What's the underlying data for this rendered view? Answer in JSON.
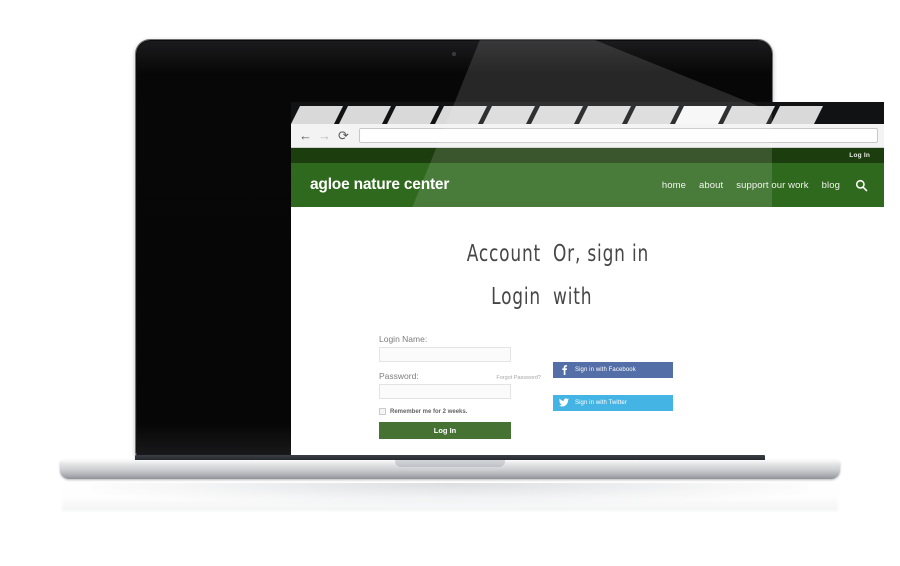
{
  "device": {
    "type": "laptop-mockup",
    "camera_icon": "camera-dot-icon"
  },
  "browser": {
    "tabs": [
      {
        "label": "",
        "active": false
      },
      {
        "label": "",
        "active": false
      },
      {
        "label": "",
        "active": false
      },
      {
        "label": "",
        "active": false
      },
      {
        "label": "",
        "active": false
      },
      {
        "label": "",
        "active": false
      },
      {
        "label": "",
        "active": false
      },
      {
        "label": "",
        "active": false
      },
      {
        "label": "",
        "active": true
      },
      {
        "label": "",
        "active": false
      },
      {
        "label": "",
        "active": false
      }
    ],
    "toolbar": {
      "back_icon": "←",
      "forward_icon": "→",
      "reload_icon": "⟳",
      "url_value": "",
      "url_placeholder": ""
    }
  },
  "site": {
    "utility_bar": {
      "login_label": "Log In"
    },
    "header": {
      "logo": "agloe nature center",
      "nav": [
        {
          "label": "home"
        },
        {
          "label": "about"
        },
        {
          "label": "support our work"
        },
        {
          "label": "blog"
        }
      ],
      "search_icon": "search-icon"
    },
    "login_panel": {
      "heading": "Account\nLogin",
      "login_name_label": "Login Name:",
      "login_name_value": "",
      "password_label": "Password:",
      "password_value": "",
      "forgot_password_label": "Forgot Password?",
      "remember_label": "Remember me for 2 weeks.",
      "remember_checked": false,
      "submit_label": "Log In"
    },
    "social_panel": {
      "heading": "Or, sign in\nwith",
      "buttons": [
        {
          "label": "Sign in with Facebook",
          "icon": "facebook-icon",
          "glyph": "f",
          "color": "#3b5a9b"
        },
        {
          "label": "Sign in with Twitter",
          "icon": "twitter-icon",
          "glyph": "✈",
          "color": "#29a9e1"
        }
      ]
    }
  },
  "colors": {
    "utility_bar_green": "#1c3d0d",
    "header_green": "#2f691d",
    "button_green": "#2b5d16",
    "facebook_blue": "#3b5a9b",
    "twitter_blue": "#29a9e1",
    "page_white": "#ffffff"
  }
}
